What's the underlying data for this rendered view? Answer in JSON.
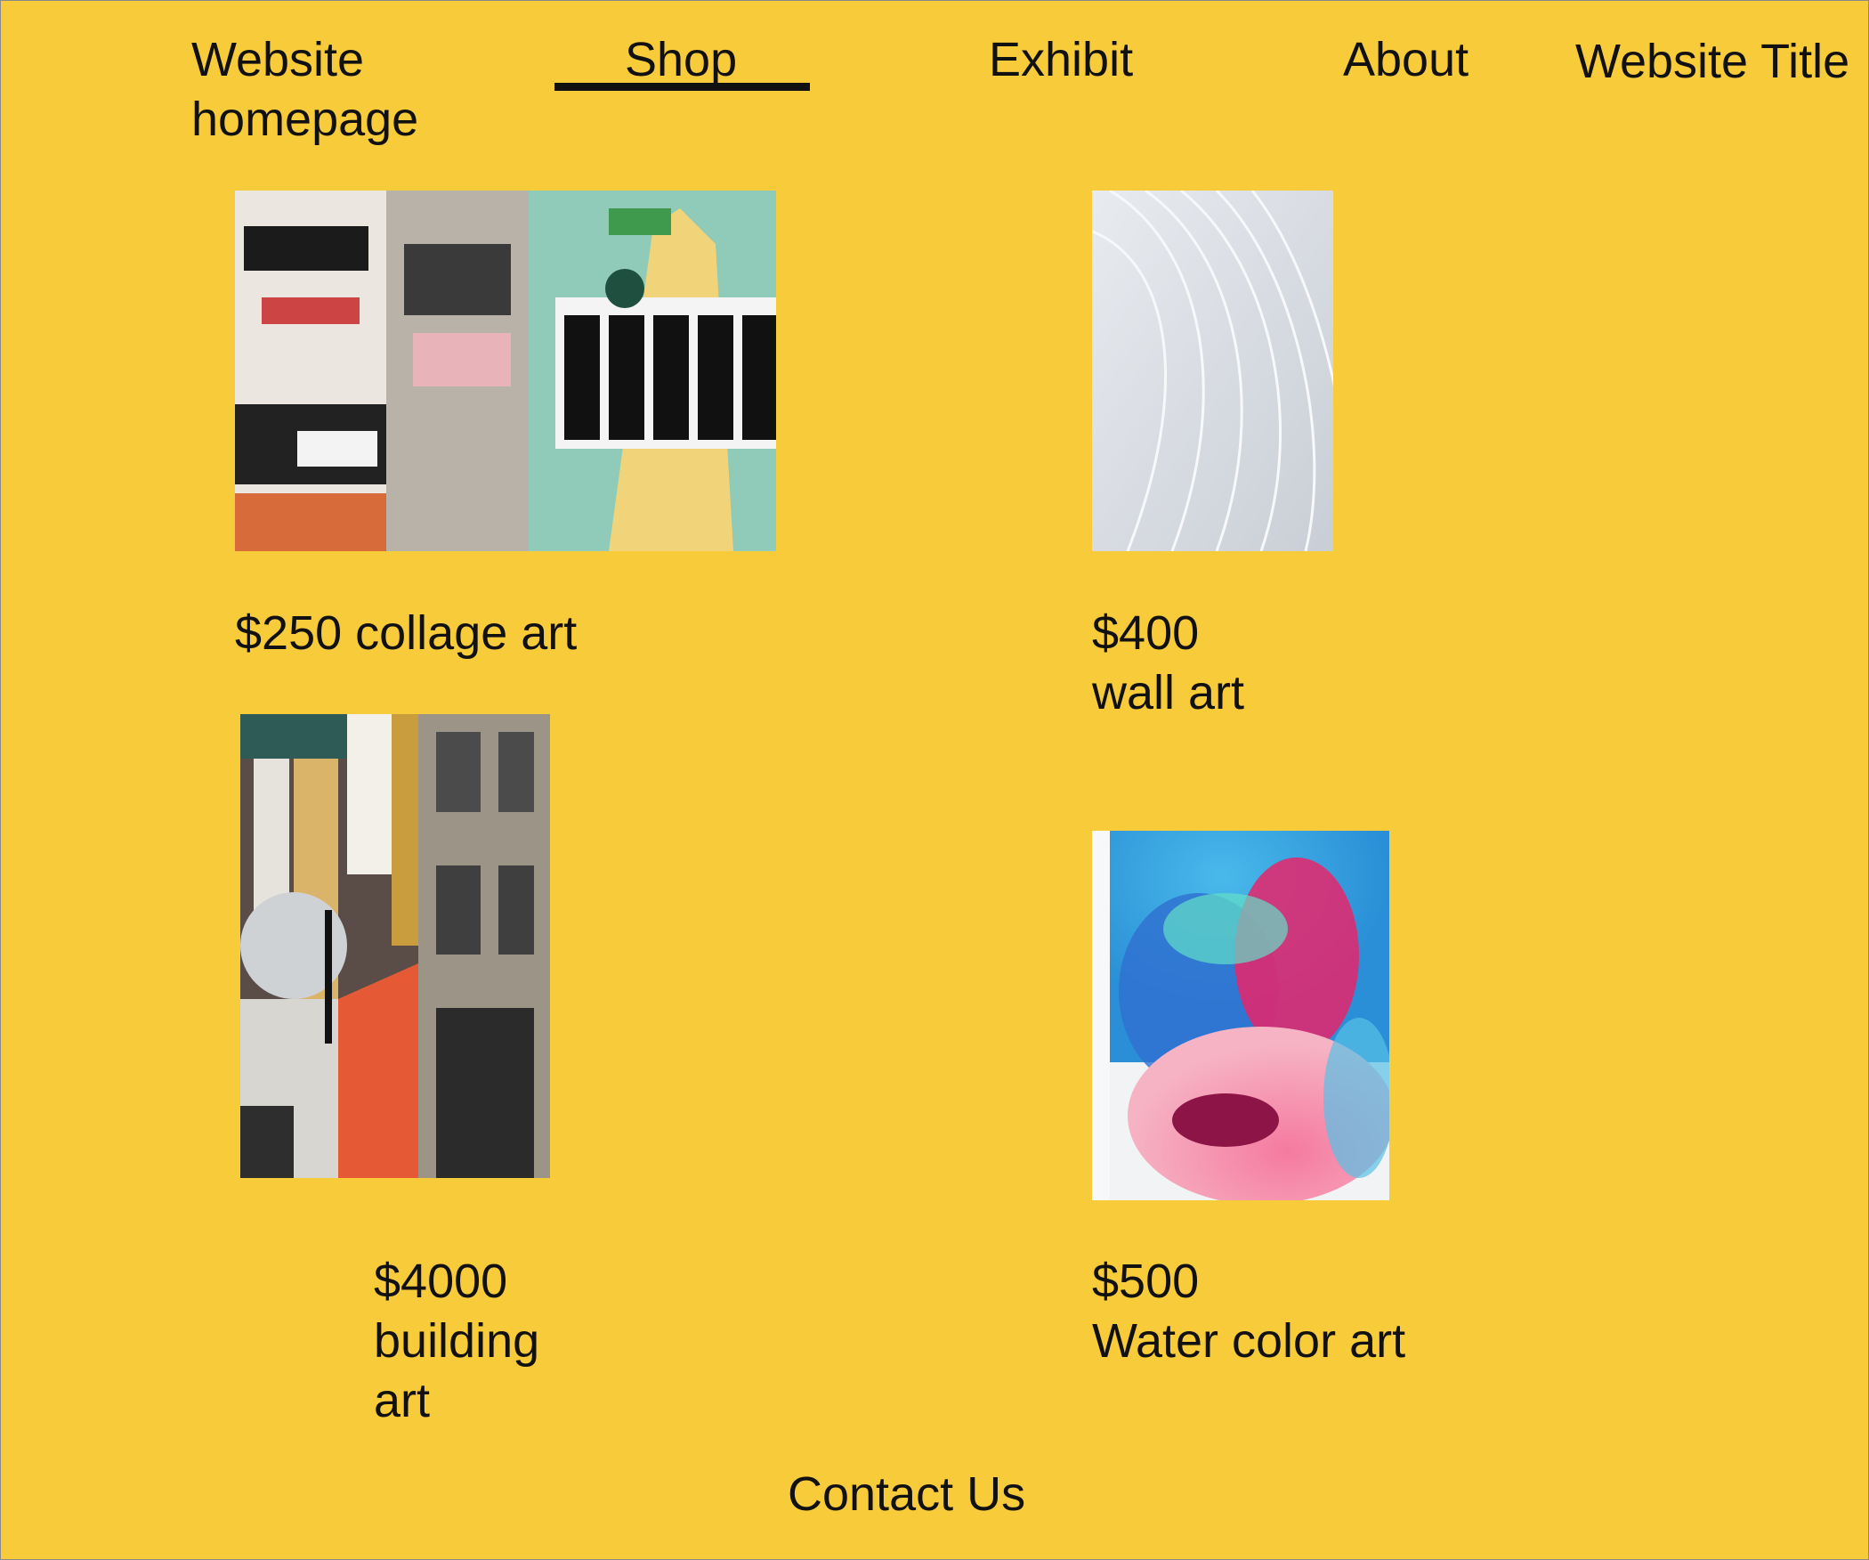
{
  "header": {
    "homepage_link": "Website\nhomepage",
    "nav": {
      "shop": "Shop",
      "exhibit": "Exhibit",
      "about": "About"
    },
    "site_title": "Website Title",
    "active_tab": "Shop"
  },
  "products": [
    {
      "price_label": "$250 collage art"
    },
    {
      "price_label": "$400\nwall art"
    },
    {
      "price_label": "$4000\nbuilding\n art"
    },
    {
      "price_label": "$500\nWater color art"
    }
  ],
  "footer": {
    "contact": "Contact Us"
  },
  "colors": {
    "background": "#f8cb3a",
    "text": "#111111"
  }
}
